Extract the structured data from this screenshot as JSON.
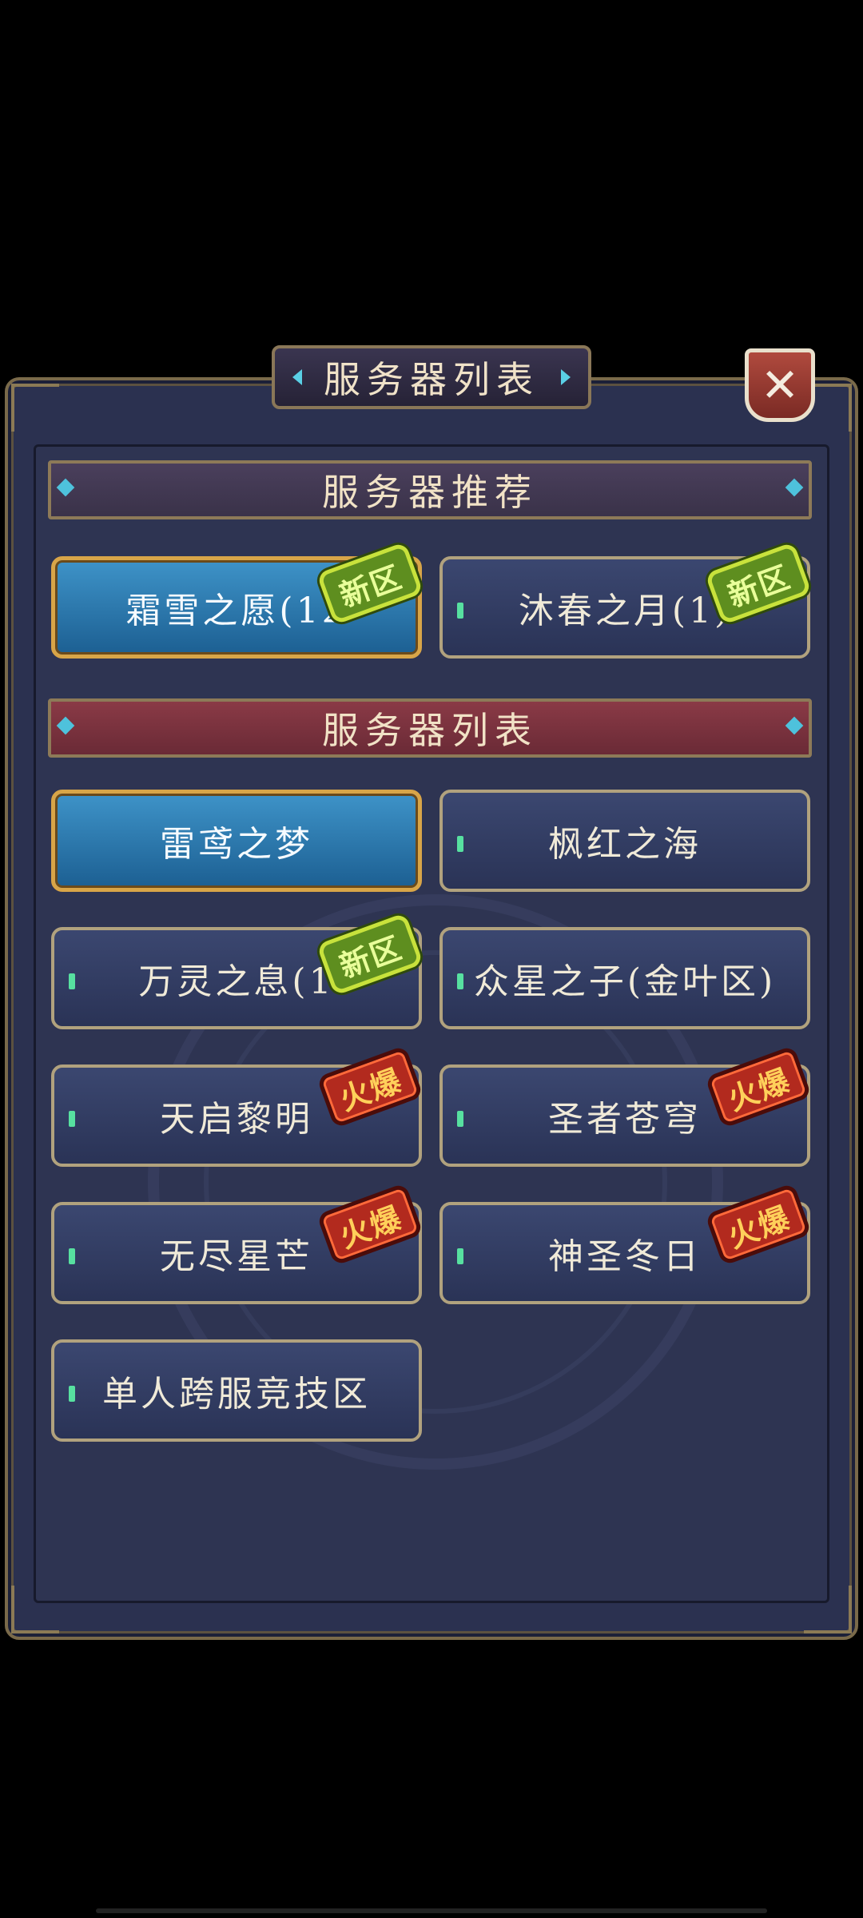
{
  "title": "服务器列表",
  "close_label": "✕",
  "sections": {
    "recommended_label": "服务器推荐",
    "list_label": "服务器列表"
  },
  "recommended": [
    {
      "name": "霜雪之愿(12",
      "state": "selected",
      "badge": "新区"
    },
    {
      "name": "沐春之月(1)",
      "state": "normal",
      "badge": "新区"
    }
  ],
  "servers": [
    {
      "name": "雷鸢之梦",
      "state": "selected",
      "badge": ""
    },
    {
      "name": "枫红之海",
      "state": "normal",
      "badge": ""
    },
    {
      "name": "万灵之息(1",
      "state": "normal",
      "badge": "新区"
    },
    {
      "name": "众星之子(金叶区)",
      "state": "normal",
      "badge": ""
    },
    {
      "name": "天启黎明",
      "state": "normal",
      "badge": "火爆"
    },
    {
      "name": "圣者苍穹",
      "state": "normal",
      "badge": "火爆"
    },
    {
      "name": "无尽星芒",
      "state": "normal",
      "badge": "火爆"
    },
    {
      "name": "神圣冬日",
      "state": "normal",
      "badge": "火爆"
    },
    {
      "name": "单人跨服竞技区",
      "state": "normal",
      "badge": ""
    }
  ],
  "colors": {
    "panel_bg": "#2b3150",
    "gold_border": "#d8a548",
    "selected_blue": "#2a7bb4",
    "new_badge": "#5e8e1f",
    "hot_badge": "#b22a1e",
    "status_dot": "#57e0a0"
  }
}
